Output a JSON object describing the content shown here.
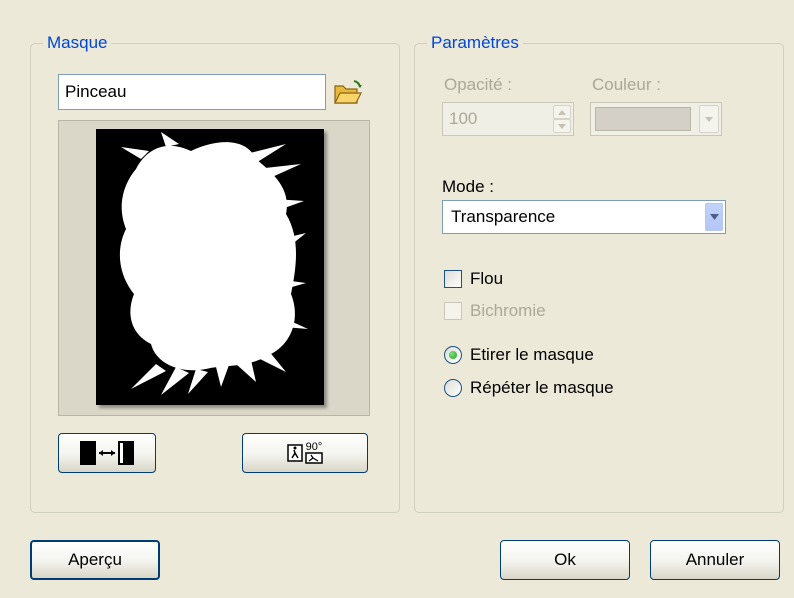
{
  "masque": {
    "title": "Masque",
    "mask_name": "Pinceau",
    "icons": {
      "open": "open-folder-icon",
      "preview": "mask-preview-image",
      "invert": "invert-mask-icon",
      "rotate": "rotate-90-icon"
    },
    "rotate_label": "90°"
  },
  "parametres": {
    "title": "Paramètres",
    "opacity_label": "Opacité :",
    "opacity_value": "100",
    "color_label": "Couleur :",
    "mode_label": "Mode :",
    "mode_value": "Transparence",
    "flou_label": "Flou",
    "bichromie_label": "Bichromie",
    "etirer_label": "Etirer le masque",
    "repeter_label": "Répéter le masque",
    "selected_fill": "etirer",
    "flou_checked": false
  },
  "footer": {
    "apercu_label": "Aperçu",
    "ok_label": "Ok",
    "annuler_label": "Annuler"
  },
  "colors": {
    "background": "#ece9d8",
    "group_title": "#0046d5",
    "disabled_text": "#aca899",
    "button_border": "#003c74"
  }
}
